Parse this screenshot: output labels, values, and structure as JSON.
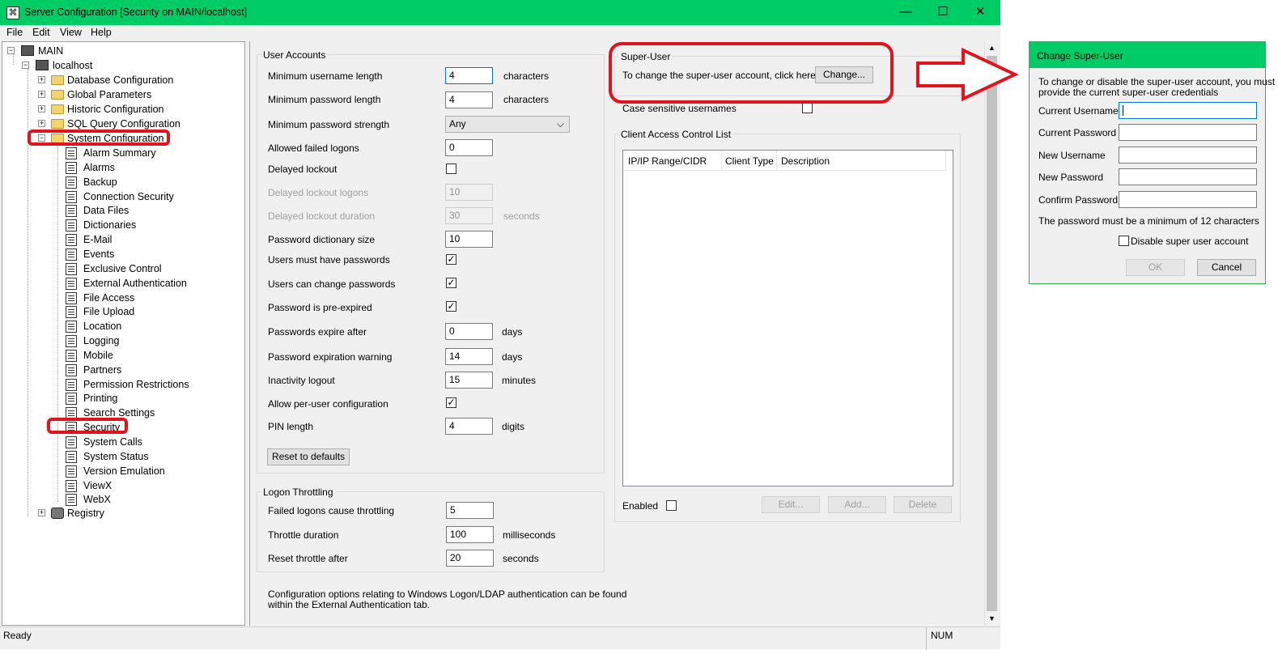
{
  "window": {
    "title": "Server Configuration [Security on MAIN/localhost]",
    "icon": "app-icon",
    "controls": [
      "minimize",
      "maximize",
      "close"
    ]
  },
  "menubar": {
    "file": "File",
    "edit": "Edit",
    "view": "View",
    "help": "Help"
  },
  "tree": {
    "root": "MAIN",
    "host": "localhost",
    "folders": [
      "Database Configuration",
      "Global Parameters",
      "Historic Configuration",
      "SQL Query Configuration",
      "System Configuration"
    ],
    "items": [
      "Alarm Summary",
      "Alarms",
      "Backup",
      "Connection Security",
      "Data Files",
      "Dictionaries",
      "E-Mail",
      "Events",
      "Exclusive Control",
      "External Authentication",
      "File Access",
      "File Upload",
      "Location",
      "Logging",
      "Mobile",
      "Partners",
      "Permission Restrictions",
      "Printing",
      "Search Settings",
      "Security",
      "System Calls",
      "System Status",
      "Version Emulation",
      "ViewX",
      "WebX"
    ],
    "registry": "Registry",
    "selected": "Security"
  },
  "user_accounts": {
    "title": "User Accounts",
    "min_username_label": "Minimum username length",
    "min_username_value": "4",
    "min_username_unit": "characters",
    "min_password_label": "Minimum password length",
    "min_password_value": "4",
    "min_password_unit": "characters",
    "strength_label": "Minimum password strength",
    "strength_value": "Any",
    "failed_logons_label": "Allowed failed logons",
    "failed_logons_value": "0",
    "delayed_lockout_label": "Delayed lockout",
    "delayed_logons_label": "Delayed lockout logons",
    "delayed_logons_value": "10",
    "delayed_duration_label": "Delayed lockout duration",
    "delayed_duration_value": "30",
    "delayed_duration_unit": "seconds",
    "dict_size_label": "Password dictionary size",
    "dict_size_value": "10",
    "must_have_label": "Users must have passwords",
    "can_change_label": "Users can change passwords",
    "pre_expired_label": "Password is pre-expired",
    "expire_after_label": "Passwords expire after",
    "expire_after_value": "0",
    "expire_after_unit": "days",
    "warning_label": "Password expiration warning",
    "warning_value": "14",
    "warning_unit": "days",
    "inactivity_label": "Inactivity logout",
    "inactivity_value": "15",
    "inactivity_unit": "minutes",
    "per_user_label": "Allow per-user configuration",
    "pin_label": "PIN length",
    "pin_value": "4",
    "pin_unit": "digits",
    "reset_button": "Reset to defaults"
  },
  "logon_throttling": {
    "title": "Logon Throttling",
    "failed_label": "Failed logons cause throttling",
    "failed_value": "5",
    "duration_label": "Throttle duration",
    "duration_value": "100",
    "duration_unit": "milliseconds",
    "reset_label": "Reset throttle after",
    "reset_value": "20",
    "reset_unit": "seconds"
  },
  "footer_note": {
    "line1": "Configuration options relating to Windows Logon/LDAP authentication can be found",
    "line2": "within the External Authentication tab."
  },
  "super_user": {
    "title": "Super-User",
    "text": "To change the super-user account, click here:",
    "button": "Change..."
  },
  "case_sensitive_label": "Case sensitive usernames",
  "acl": {
    "title": "Client Access Control List",
    "col_range": "IP/IP Range/CIDR",
    "col_type": "Client Type",
    "col_desc": "Description",
    "enabled_label": "Enabled",
    "edit_button": "Edit...",
    "add_button": "Add...",
    "delete_button": "Delete"
  },
  "statusbar": {
    "left": "Ready",
    "right": "NUM"
  },
  "dialog": {
    "title": "Change Super-User",
    "intro_line1": "To change or disable the super-user account, you must",
    "intro_line2": "provide the current super-user credentials",
    "current_username": "Current Username",
    "current_password": "Current Password",
    "new_username": "New Username",
    "new_password": "New Password",
    "confirm_password": "Confirm Password",
    "min_note": "The password must be a minimum of 12 characters",
    "disable_label": "Disable super user account",
    "ok": "OK",
    "cancel": "Cancel"
  },
  "colors": {
    "titlebar": "#00cc66",
    "annotation": "#e2131d"
  }
}
